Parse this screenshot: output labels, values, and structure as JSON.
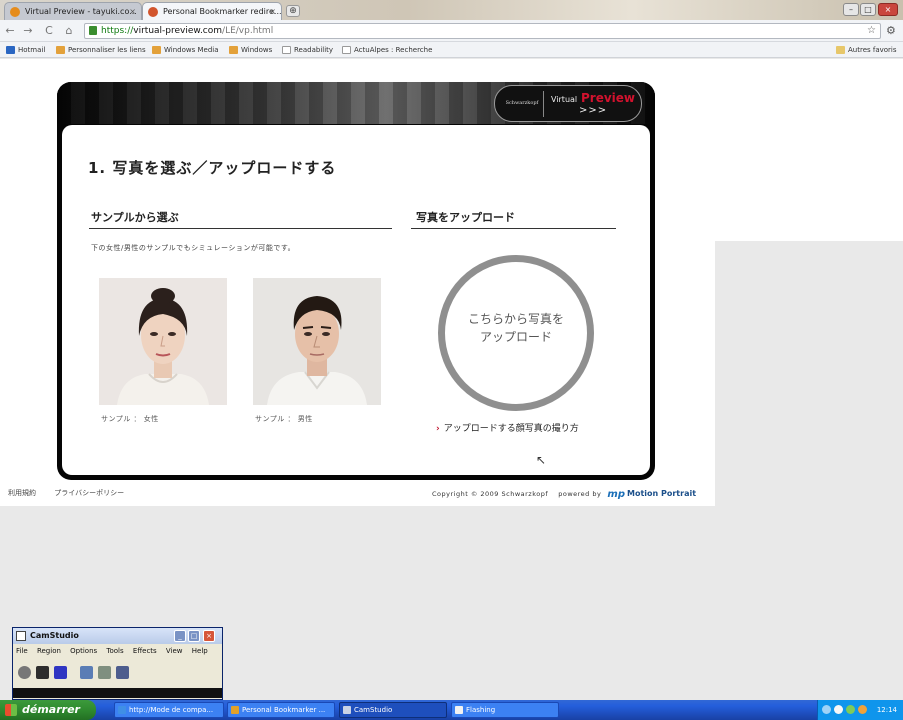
{
  "browser": {
    "tabs": [
      {
        "label": "Virtual Preview - tayuki.co...",
        "active": false
      },
      {
        "label": "Personal Bookmarker redire...",
        "active": true
      }
    ],
    "new_tab": "⊕",
    "window_controls": {
      "minimize": "–",
      "maximize": "□",
      "close": "×"
    },
    "nav": {
      "back": "←",
      "forward": "→",
      "reload": "C",
      "home": "⌂"
    },
    "url": {
      "scheme": "https://",
      "host": "virtual-preview.com",
      "path": "/LE/vp.html"
    },
    "bookmarks": [
      "Hotmail",
      "Personnaliser les liens",
      "Windows Media",
      "Windows",
      "Readability",
      "ActuAlpes : Recherche"
    ],
    "other_bookmarks": "Autres favoris"
  },
  "page": {
    "logo": {
      "brand": "Schwarzkopf",
      "virtual": "Virtual",
      "preview": "Preview",
      "arrows": ">>>"
    },
    "step_title": "1. 写真を選ぶ／アップロードする",
    "sample_heading": "サンプルから選ぶ",
    "sample_desc": "下の女性/男性のサンプルでもシミュレーションが可能です。",
    "samples": [
      {
        "caption": "サンプル ： 女性"
      },
      {
        "caption": "サンプル ： 男性"
      }
    ],
    "upload_heading": "写真をアップロード",
    "upload_button": {
      "line1": "こちらから写真を",
      "line2": "アップロード"
    },
    "howto_arrow": "›",
    "howto_link": "アップロードする顔写真の撮り方"
  },
  "footer": {
    "terms": "利用規約",
    "privacy": "プライバシーポリシー",
    "copyright": "Copyright © 2009 Schwarzkopf",
    "powered_by": "powered by",
    "mp_logo": "mp",
    "motion_portrait": "Motion Portrait"
  },
  "camstudio": {
    "title": "CamStudio",
    "menu": [
      "File",
      "Region",
      "Options",
      "Tools",
      "Effects",
      "View",
      "Help"
    ]
  },
  "taskbar": {
    "start": "démarrer",
    "tasks": [
      {
        "label": "http://Mode de compa...",
        "active": false
      },
      {
        "label": "Personal Bookmarker ...",
        "active": false
      },
      {
        "label": "CamStudio",
        "active": true
      },
      {
        "label": "Flashing",
        "active": false
      }
    ],
    "clock": "12:14"
  },
  "colors": {
    "brand_red": "#d2122e",
    "upload_ring": "#8f8f8f",
    "taskbar_blue": "#245edb",
    "start_green": "#2f8a2f"
  }
}
